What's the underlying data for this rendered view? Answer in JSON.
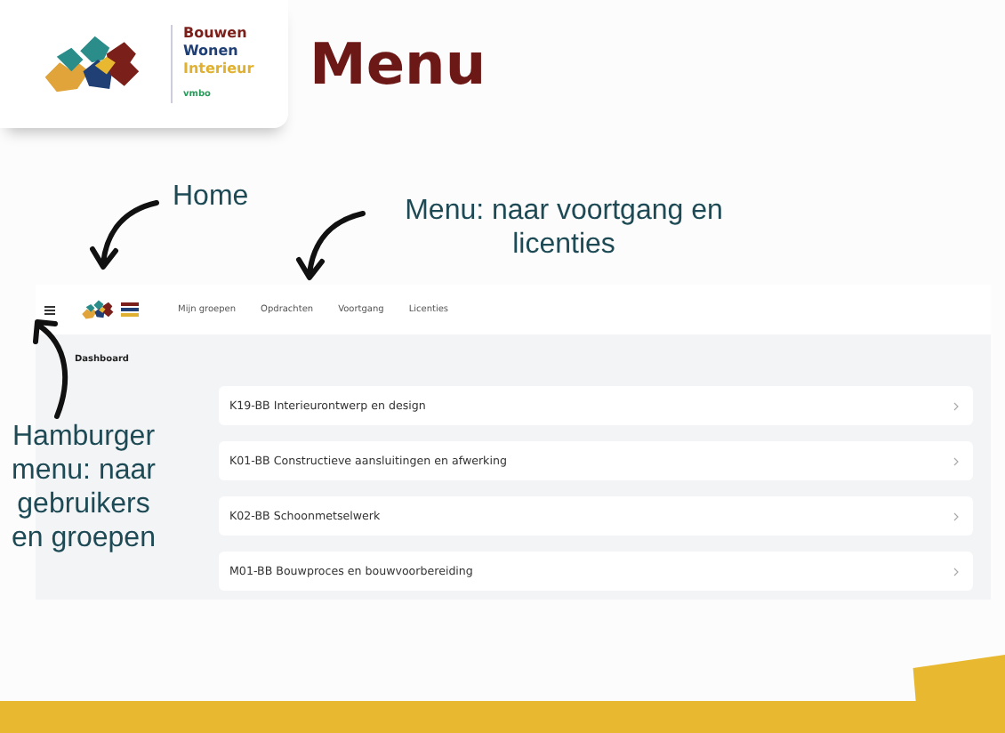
{
  "header": {
    "logo_lines": [
      "Bouwen",
      "Wonen",
      "Interieur",
      "vmbo"
    ],
    "title": "Menu"
  },
  "annotations": [
    {
      "kind": "home",
      "text": "Home"
    },
    {
      "kind": "menu",
      "text": "Menu: naar voortgang en licenties"
    },
    {
      "kind": "hamburger",
      "text": "Hamburger menu: naar gebruikers en groepen"
    }
  ],
  "app": {
    "nav_items": [
      "Mijn groepen",
      "Opdrachten",
      "Voortgang",
      "Licenties"
    ],
    "page_title": "Dashboard",
    "courses": [
      "K19-BB Interieurontwerp en design",
      "K01-BB Constructieve aansluitingen en afwerking",
      "K02-BB Schoonmetselwerk",
      "M01-BB Bouwproces en bouwvoorbereiding"
    ]
  }
}
